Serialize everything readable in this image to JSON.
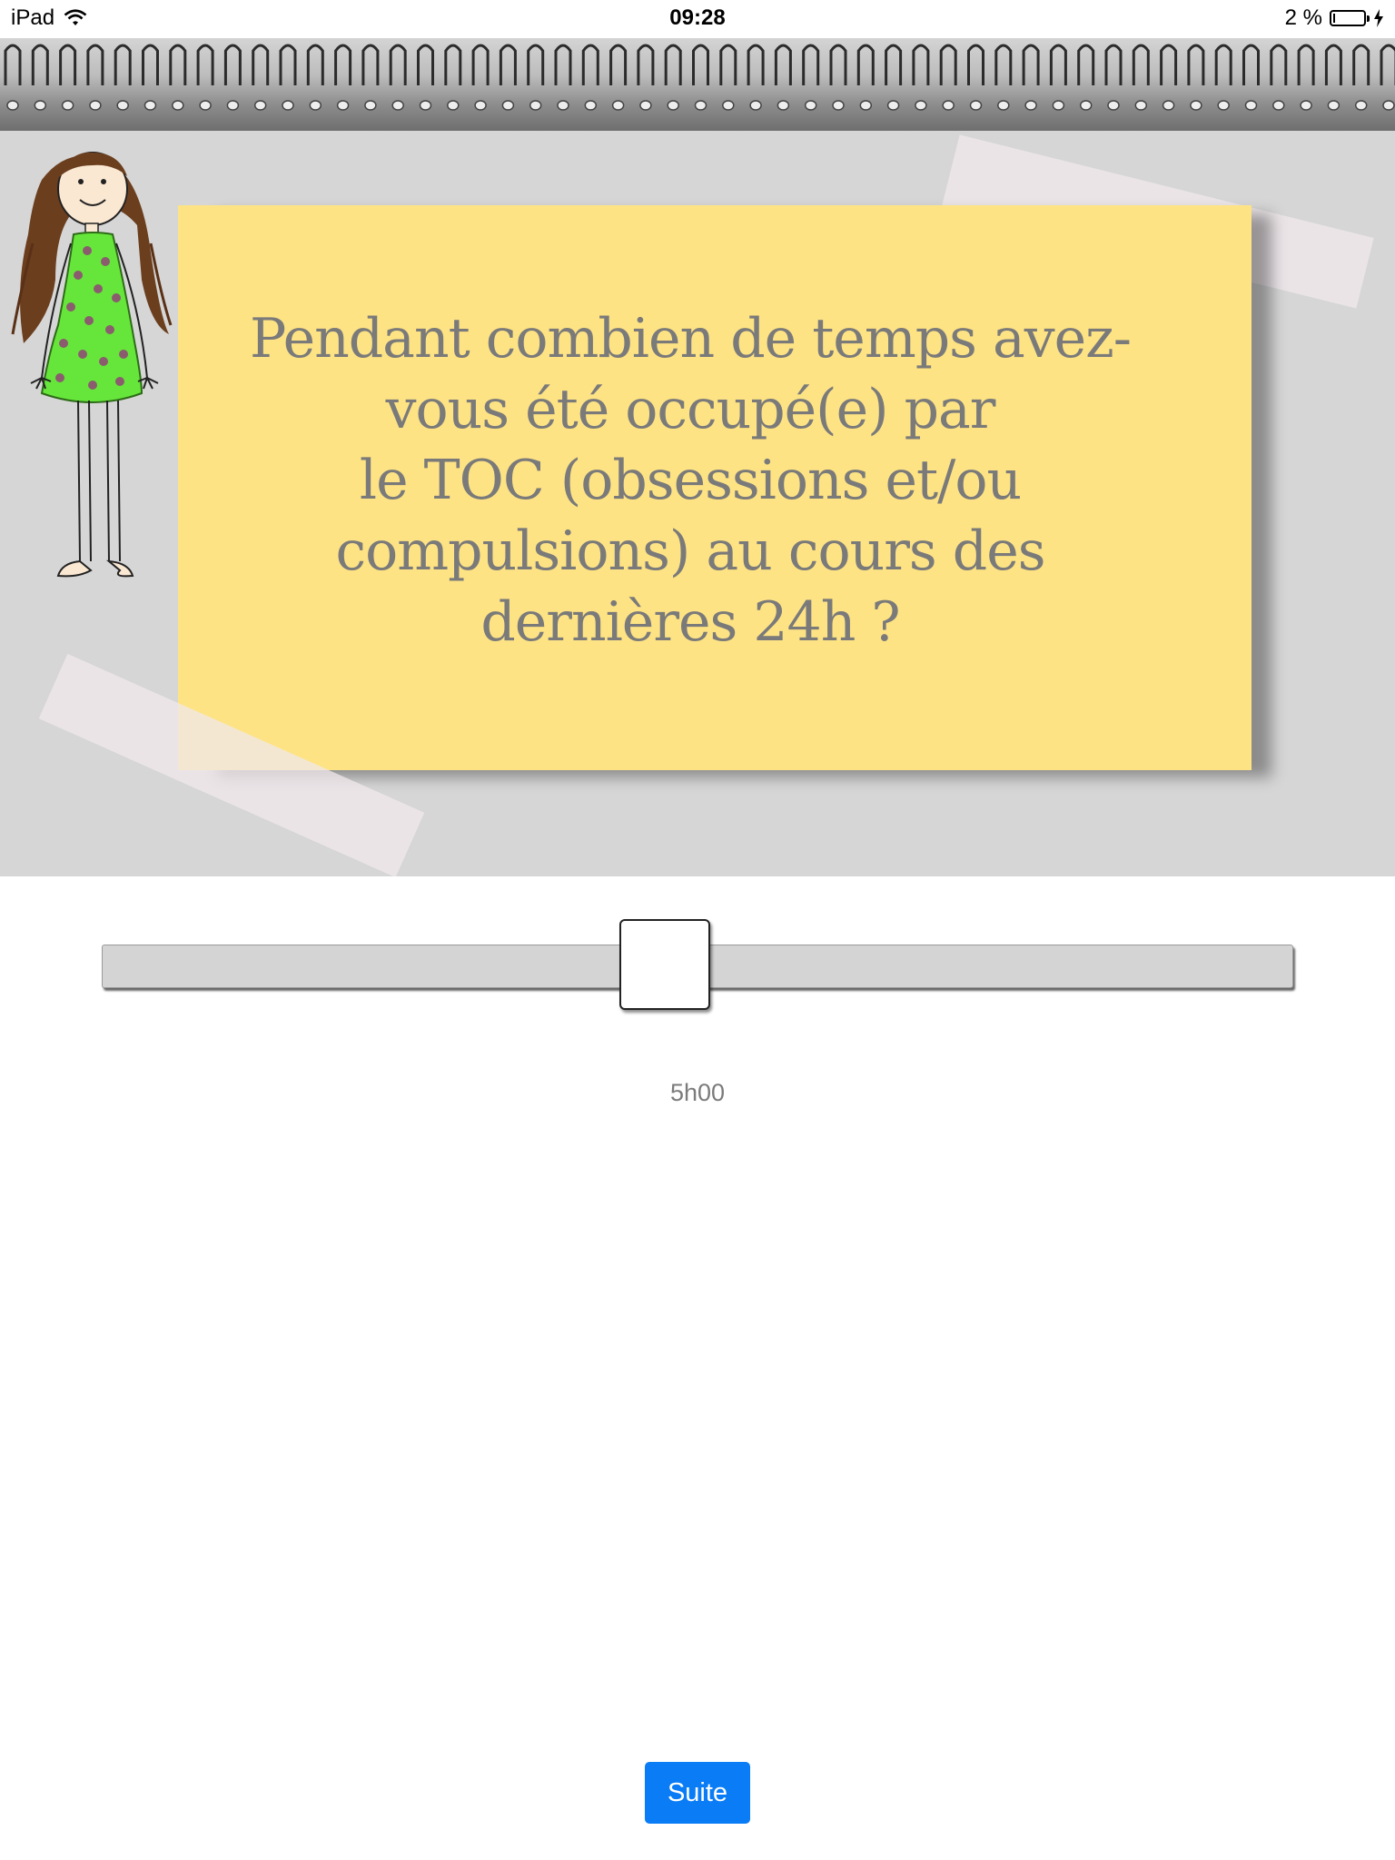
{
  "status_bar": {
    "device": "iPad",
    "time": "09:28",
    "battery_percent": "2 %"
  },
  "question": {
    "lines": [
      "Pendant combien de temps avez-",
      "vous été occupé(e) par",
      "le TOC (obsessions et/ou",
      "compulsions) au cours des",
      "dernières 24h ?"
    ]
  },
  "slider": {
    "value_label": "5h00",
    "position_fraction": 0.47
  },
  "footer": {
    "next_button_label": "Suite"
  },
  "colors": {
    "note_yellow": "#fee384",
    "panel_gray": "#d6d6d6",
    "button_blue": "#0a7cf5",
    "question_text": "#7a7a7a"
  },
  "icons": [
    "wifi-icon",
    "battery-icon",
    "charging-bolt-icon",
    "spiral-binding",
    "girl-illustration"
  ]
}
